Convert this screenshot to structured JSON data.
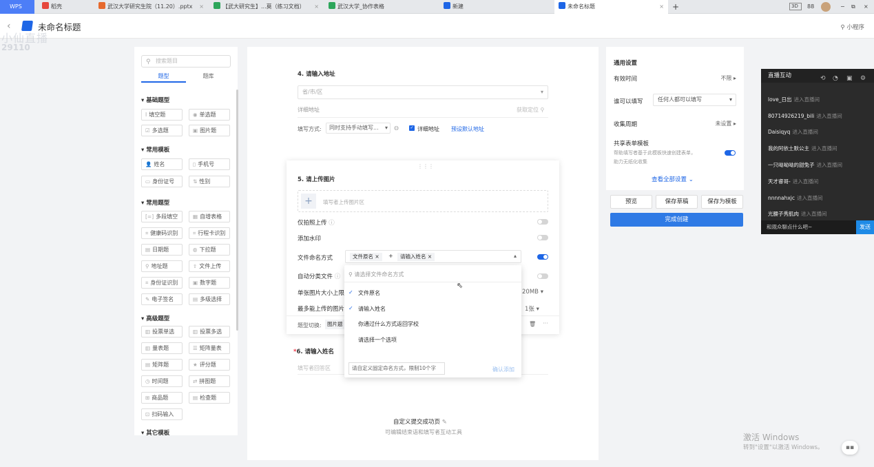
{
  "tabs": {
    "wps": "WPS",
    "items": [
      {
        "label": "稻壳",
        "color": "#e6473c"
      },
      {
        "label": "武汉大学研究生院（11.20）.pptx",
        "color": "#e6692d"
      },
      {
        "label": "【武大研究生】...莫（练习文档）",
        "color": "#2da65b"
      },
      {
        "label": "武汉大学_协作表格",
        "color": "#2da65b"
      },
      {
        "label": "新建",
        "color": "#1e66e6"
      },
      {
        "label": "未命名标题",
        "color": "#1e66e6"
      }
    ],
    "add": "+",
    "close": "×",
    "window_controls": [
      "3D",
      "88",
      "−",
      "⧉",
      "×"
    ]
  },
  "header": {
    "back": "‹",
    "title": "未命名标题",
    "mini_program": "小程序"
  },
  "watermark": {
    "line1": "小仙直播",
    "line2": "29110"
  },
  "left_panel": {
    "search_placeholder": "搜索题目",
    "tabs": [
      "题型",
      "题库"
    ],
    "sections": [
      {
        "title": "基础题型",
        "items": [
          {
            "icon": "I",
            "label": "填空题"
          },
          {
            "icon": "◉",
            "label": "单选题"
          },
          {
            "icon": "☑",
            "label": "多选题"
          },
          {
            "icon": "▣",
            "label": "图片题"
          }
        ]
      },
      {
        "title": "常用模板",
        "items": [
          {
            "icon": "👤",
            "label": "姓名"
          },
          {
            "icon": "▯",
            "label": "手机号"
          },
          {
            "icon": "▭",
            "label": "身份证号"
          },
          {
            "icon": "⇅",
            "label": "性别"
          }
        ]
      },
      {
        "title": "常用题型",
        "items": [
          {
            "icon": "[=]",
            "label": "多段填空"
          },
          {
            "icon": "▦",
            "label": "自增表格"
          },
          {
            "icon": "⌗",
            "label": "健康码识别"
          },
          {
            "icon": "⌗",
            "label": "行程卡识别"
          },
          {
            "icon": "▤",
            "label": "日期题"
          },
          {
            "icon": "◍",
            "label": "下拉题"
          },
          {
            "icon": "⚲",
            "label": "地址题"
          },
          {
            "icon": "⇧",
            "label": "文件上传"
          },
          {
            "icon": "⌗",
            "label": "身份证识别"
          },
          {
            "icon": "▣",
            "label": "数字题"
          },
          {
            "icon": "✎",
            "label": "电子签名"
          },
          {
            "icon": "▤",
            "label": "多级选择"
          }
        ]
      },
      {
        "title": "高级题型",
        "items": [
          {
            "icon": "▥",
            "label": "投票单选"
          },
          {
            "icon": "▥",
            "label": "投票多选"
          },
          {
            "icon": "▥",
            "label": "量表题"
          },
          {
            "icon": "☰",
            "label": "矩阵量表"
          },
          {
            "icon": "▤",
            "label": "矩阵题"
          },
          {
            "icon": "★",
            "label": "评分题"
          },
          {
            "icon": "◷",
            "label": "时间题"
          },
          {
            "icon": "⇄",
            "label": "拼图题"
          },
          {
            "icon": "⊞",
            "label": "商品题"
          },
          {
            "icon": "▤",
            "label": "检查题"
          },
          {
            "icon": "⊡",
            "label": "扫码输入"
          }
        ]
      },
      {
        "title": "其它模板",
        "items": []
      }
    ]
  },
  "form": {
    "q4": {
      "title": "4. 请输入地址",
      "region_placeholder": "省/市/区",
      "detail_placeholder": "详细地址",
      "locate": "获取定位",
      "fill_mode_label": "填写方式:",
      "fill_mode_value": "同时支持手动填写...",
      "detail_checkbox": "详细地址",
      "default_addr": "预设默认地址"
    },
    "q5": {
      "title": "5. 请上传图片",
      "upload_placeholder": "填写者上传图片区",
      "options": [
        {
          "label": "仅拍照上传",
          "on": false
        },
        {
          "label": "添加水印",
          "on": false
        },
        {
          "label": "文件命名方式",
          "on": true
        },
        {
          "label": "自动分类文件",
          "on": false
        },
        {
          "label": "单张图片大小上限",
          "value": "20MB"
        },
        {
          "label": "最多能上传的图片",
          "value": "1张"
        }
      ],
      "naming_tags": [
        "文件原名",
        "请输入姓名"
      ],
      "type_switch_label": "题型切换:",
      "type_switch_value": "图片题"
    },
    "q6": {
      "title": "6. 请输入姓名",
      "placeholder": "填写者回答区",
      "required_mark": "*"
    },
    "footer_link": "自定义提交成功页",
    "footer_sub": "可编辑结束语和填写者互动工具"
  },
  "dropdown": {
    "search_placeholder": "请选择文件命名方式",
    "items": [
      {
        "label": "文件原名",
        "checked": true
      },
      {
        "label": "请输入姓名",
        "checked": true
      },
      {
        "label": "你通过什么方式返回学校",
        "checked": false
      },
      {
        "label": "请选择一个选项",
        "checked": false
      }
    ],
    "custom_placeholder": "请自定义固定命名方式，限制10个字",
    "confirm": "确认添加"
  },
  "settings": {
    "title": "通用设置",
    "valid_time_label": "有效时间",
    "valid_time_value": "不限",
    "who_label": "谁可以填写",
    "who_value": "任何人都可以填写",
    "cycle_label": "收集周期",
    "cycle_value": "未设置",
    "share_title": "共享表单模板",
    "share_desc1": "帮助填写者基于此模板快速创建表单，",
    "share_desc2": "助力无纸化收集",
    "view_all": "查看全部设置",
    "buttons": {
      "preview": "预览",
      "save_draft": "保存草稿",
      "save_template": "保存为模板",
      "finish": "完成创建"
    }
  },
  "live": {
    "title": "直播互动",
    "messages": [
      {
        "user": "love_日出",
        "action": "进入直播间"
      },
      {
        "user": "80714926219_bili",
        "action": "进入直播间"
      },
      {
        "user": "Daisiqyq",
        "action": "进入直播间"
      },
      {
        "user": "我的阿依土默公主",
        "action": "进入直播间"
      },
      {
        "user": "一只呦呦呦的甜兔子",
        "action": "进入直播间"
      },
      {
        "user": "天才睿哥-",
        "action": "进入直播间"
      },
      {
        "user": "nnnnahxjc",
        "action": "进入直播间"
      },
      {
        "user": "光腰子秀肌肉",
        "action": "进入直播间"
      }
    ],
    "input_placeholder": "和观众聊点什么吧~",
    "send": "发送"
  },
  "windows_activation": {
    "line1": "激活 Windows",
    "line2": "转到\"设置\"以激活 Windows。"
  }
}
